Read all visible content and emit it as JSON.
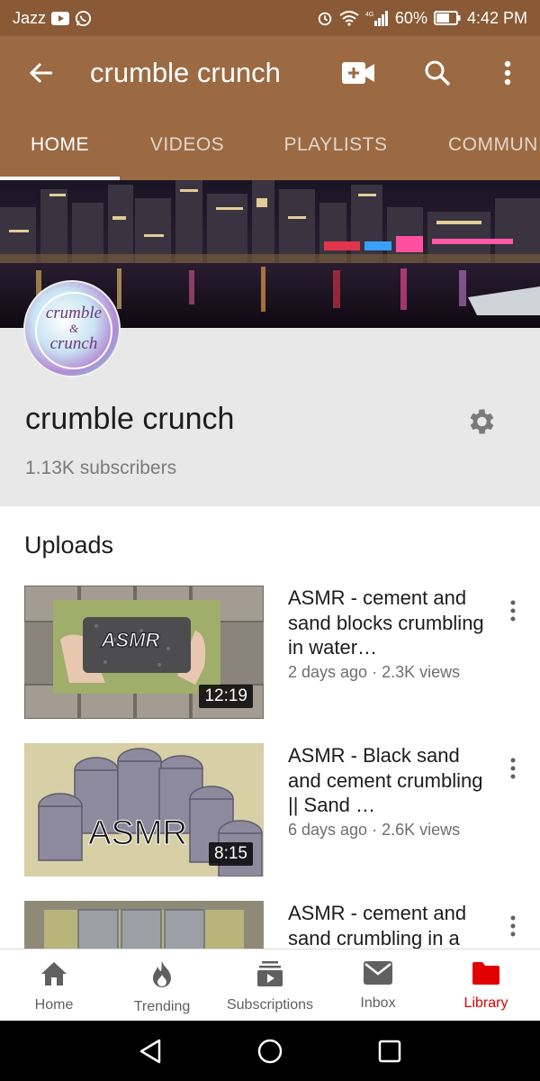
{
  "status_bar": {
    "carrier": "Jazz",
    "network": "4G",
    "battery": "60%",
    "time": "4:42 PM",
    "icons": [
      "youtube-notification-icon",
      "whatsapp-icon",
      "alarm-icon",
      "wifi-icon",
      "signal-icon",
      "battery-icon"
    ]
  },
  "app_bar": {
    "title": "crumble crunch",
    "icons": [
      "back-arrow-icon",
      "video-camera-icon",
      "search-icon",
      "more-vert-icon"
    ]
  },
  "tabs": [
    {
      "label": "HOME",
      "active": true
    },
    {
      "label": "VIDEOS",
      "active": false
    },
    {
      "label": "PLAYLISTS",
      "active": false
    },
    {
      "label": "COMMUN",
      "active": false
    }
  ],
  "channel": {
    "name": "crumble crunch",
    "subscribers": "1.13K subscribers",
    "avatar_text_line1": "crumble",
    "avatar_text_line2": "&",
    "avatar_text_line3": "crunch"
  },
  "uploads": {
    "title": "Uploads",
    "videos": [
      {
        "title": "ASMR - cement and sand blocks crumbling in water…",
        "meta": "2 days ago · 2.3K views",
        "duration": "12:19",
        "thumb_text": "ASMR"
      },
      {
        "title": "ASMR - Black sand and cement crumbling || Sand …",
        "meta": "6 days ago · 2.6K views",
        "duration": "8:15",
        "thumb_text": "ASMR"
      },
      {
        "title": "ASMR - cement and sand crumbling in a",
        "meta": "",
        "duration": "",
        "thumb_text": ""
      }
    ]
  },
  "bottom_nav": [
    {
      "label": "Home",
      "icon": "home-icon",
      "active": false
    },
    {
      "label": "Trending",
      "icon": "trending-flame-icon",
      "active": false
    },
    {
      "label": "Subscriptions",
      "icon": "subscriptions-icon",
      "active": false
    },
    {
      "label": "Inbox",
      "icon": "inbox-icon",
      "active": false
    },
    {
      "label": "Library",
      "icon": "library-folder-icon",
      "active": true
    }
  ],
  "colors": {
    "brand_brown": "#9b6a43",
    "status_brown": "#8a5a36",
    "active_red": "#e00000"
  }
}
